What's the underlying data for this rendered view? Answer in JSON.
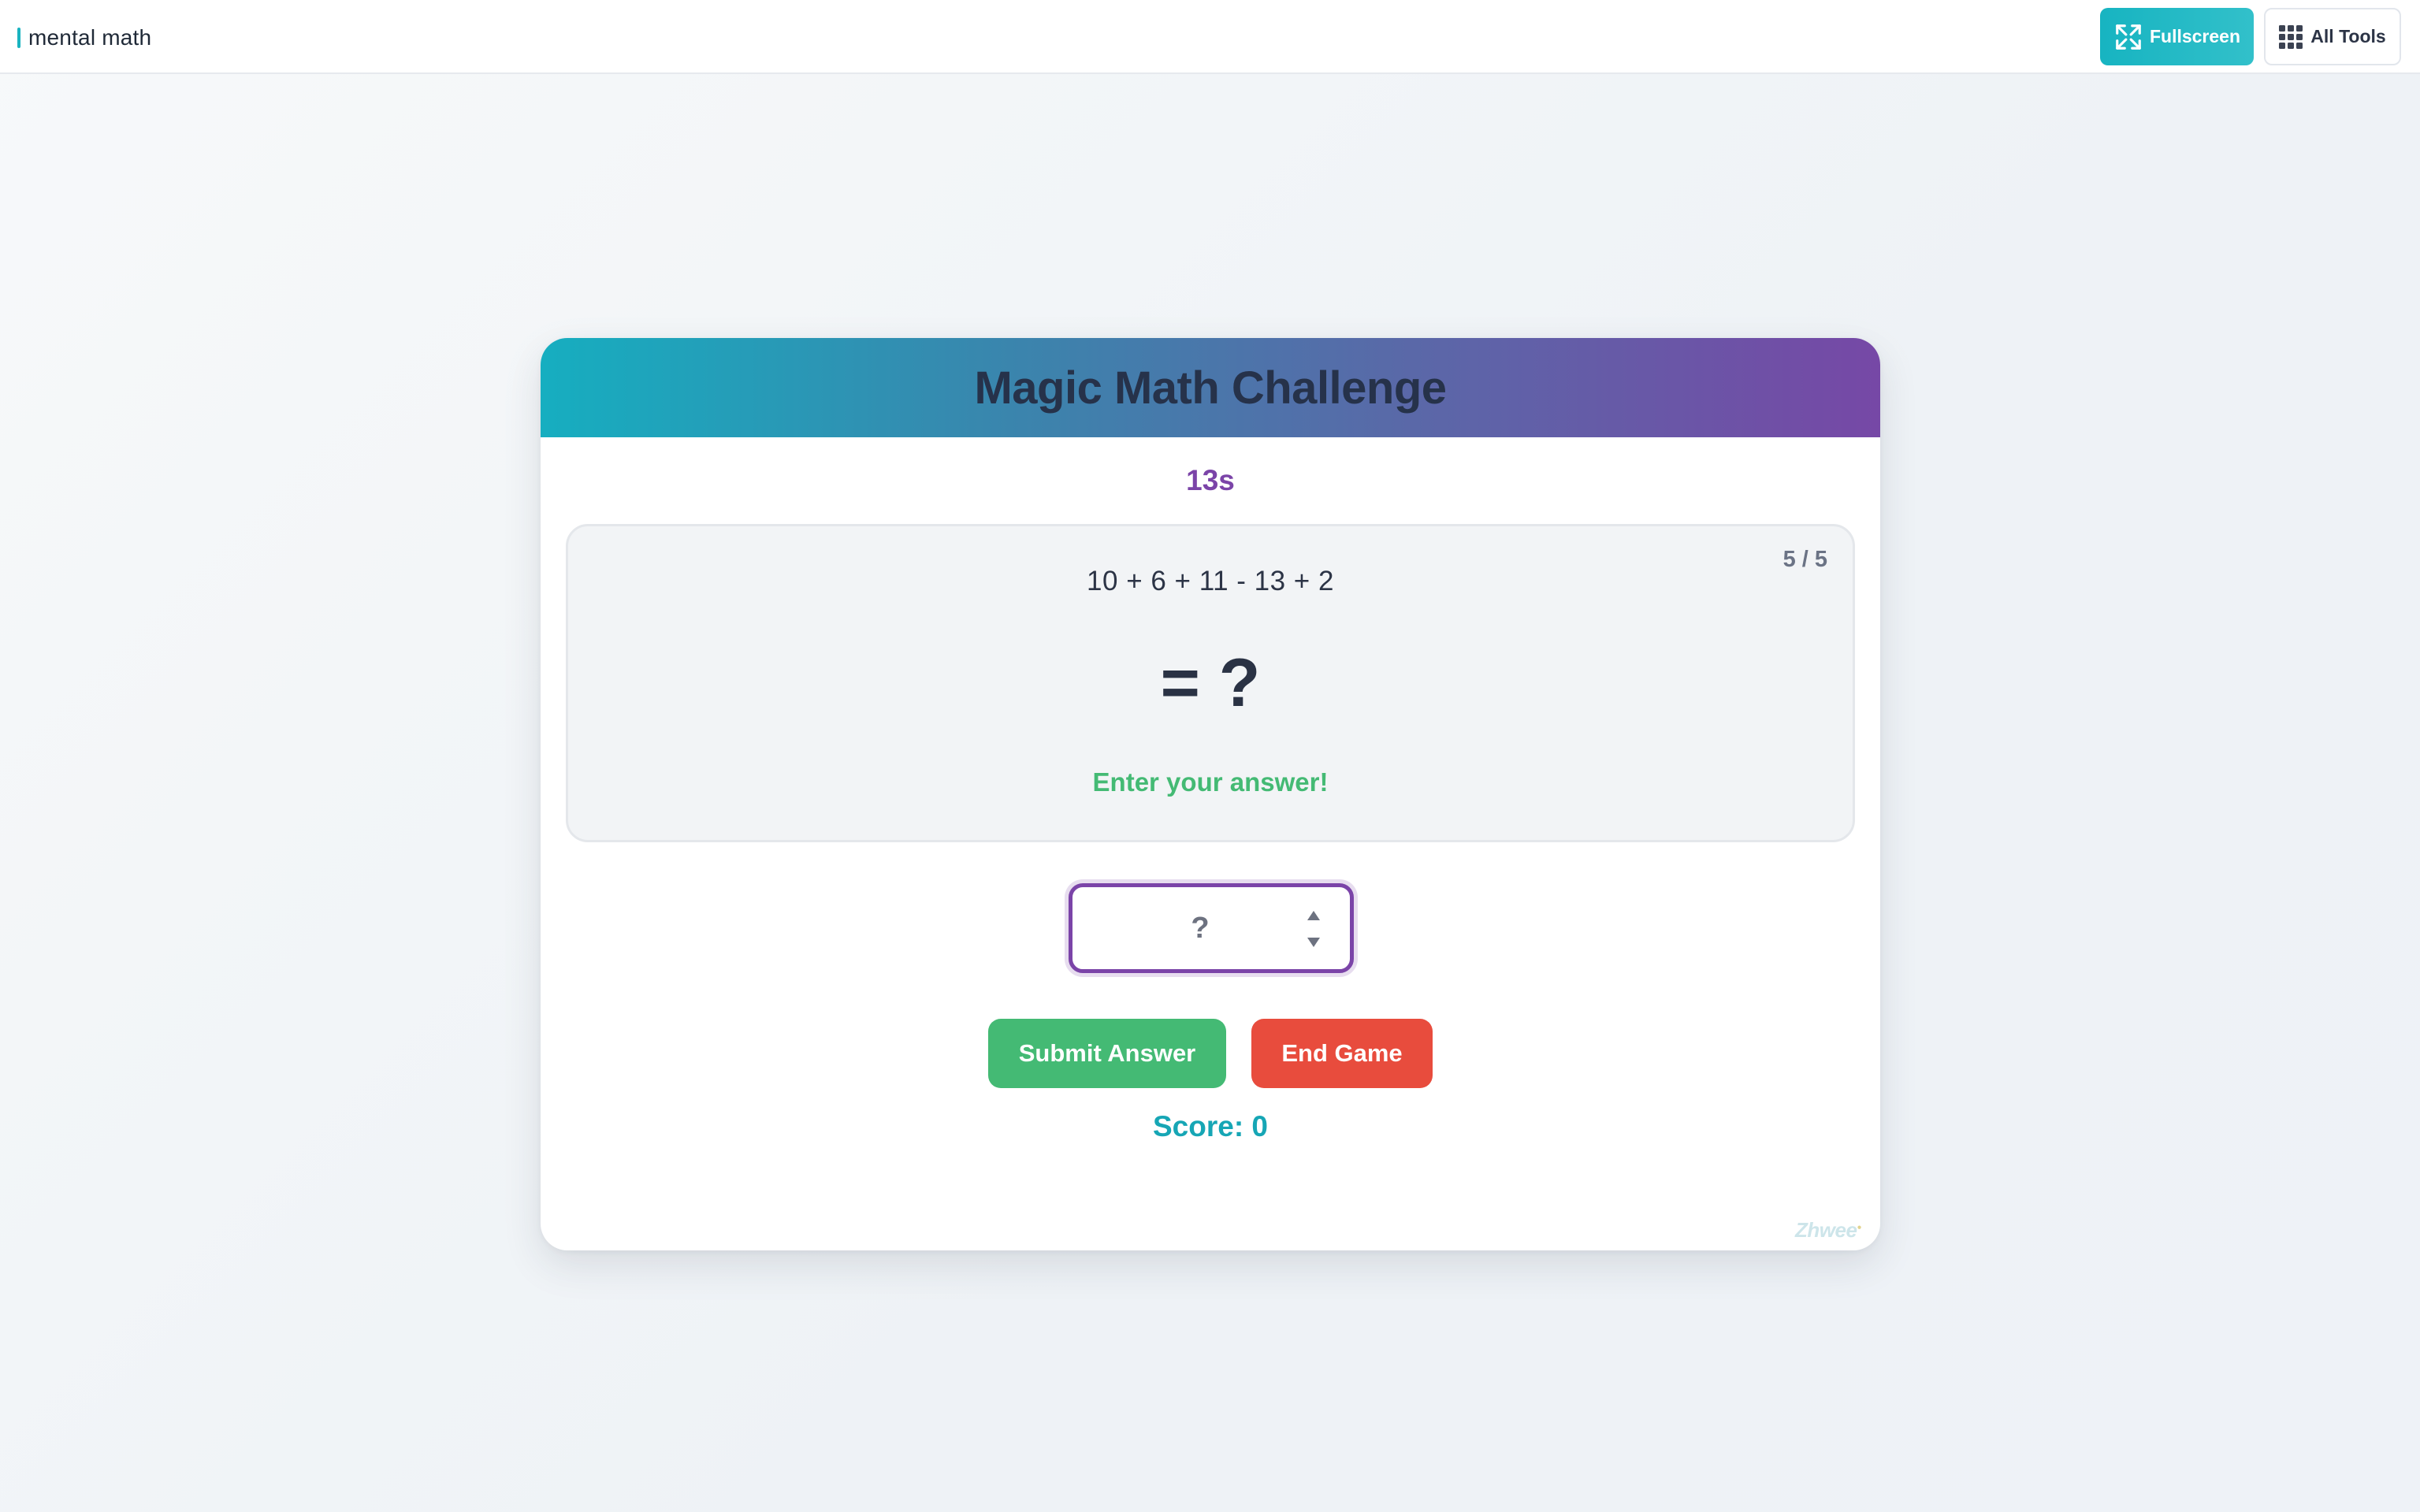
{
  "topbar": {
    "brand": "mental math",
    "fullscreen_label": "Fullscreen",
    "all_tools_label": "All Tools",
    "icons": {
      "fullscreen": "expand-arrows-icon",
      "all_tools": "grid-icon"
    }
  },
  "game": {
    "title": "Magic Math Challenge",
    "timer": "13s",
    "progress": "5 / 5",
    "expression": "10 + 6 + 11 - 13 + 2",
    "equals": "= ?",
    "feedback": "Enter your answer!",
    "answer": {
      "value": "",
      "placeholder": "?"
    },
    "submit_label": "Submit Answer",
    "end_label": "End Game",
    "score": "Score: 0",
    "watermark": "Zhwee"
  },
  "colors": {
    "accent_teal": "#17b4c1",
    "accent_purple": "#7b44a8",
    "success_green": "#44ba74",
    "danger_red": "#e84c3d",
    "score_teal": "#16a6b5"
  }
}
